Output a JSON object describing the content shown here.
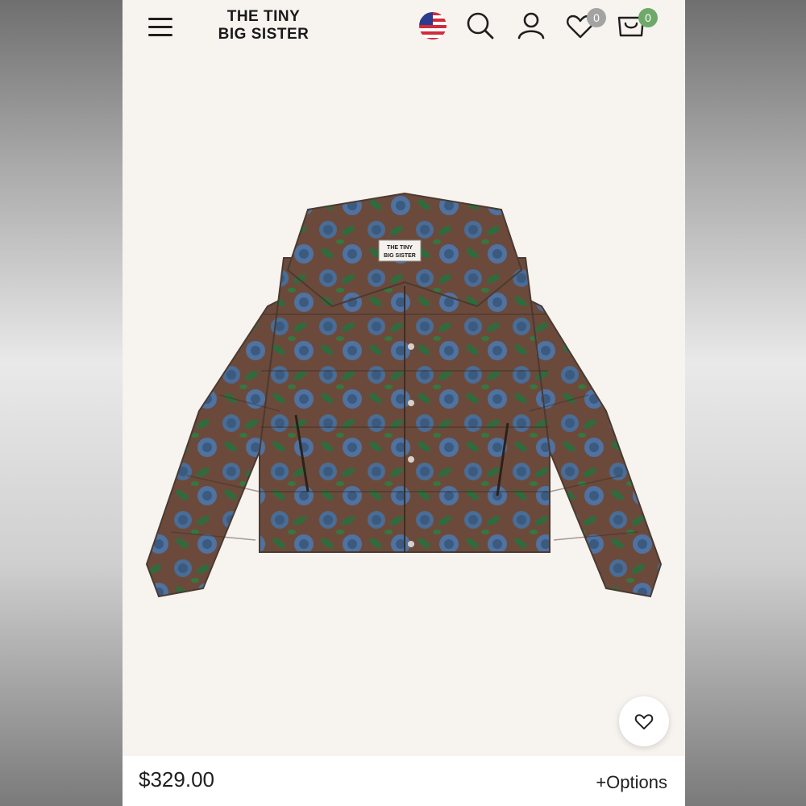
{
  "header": {
    "brand_line1": "THE TINY",
    "brand_line2": "BIG SISTER",
    "menu_icon": "hamburger-menu-icon",
    "region_icon": "us-flag-icon",
    "search_icon": "search-icon",
    "account_icon": "user-icon",
    "wishlist_icon": "heart-icon",
    "wishlist_count": "0",
    "cart_icon": "cart-icon",
    "cart_count": "0"
  },
  "product": {
    "image_label_line1": "THE TINY",
    "image_label_line2": "BIG SISTER",
    "price": "$329.00",
    "options_label": "+Options",
    "favorite_icon": "heart-icon"
  },
  "colors": {
    "wishlist_badge": "#a3a3a3",
    "cart_badge": "#6fa96a",
    "page_background": "#f7f3ef"
  }
}
